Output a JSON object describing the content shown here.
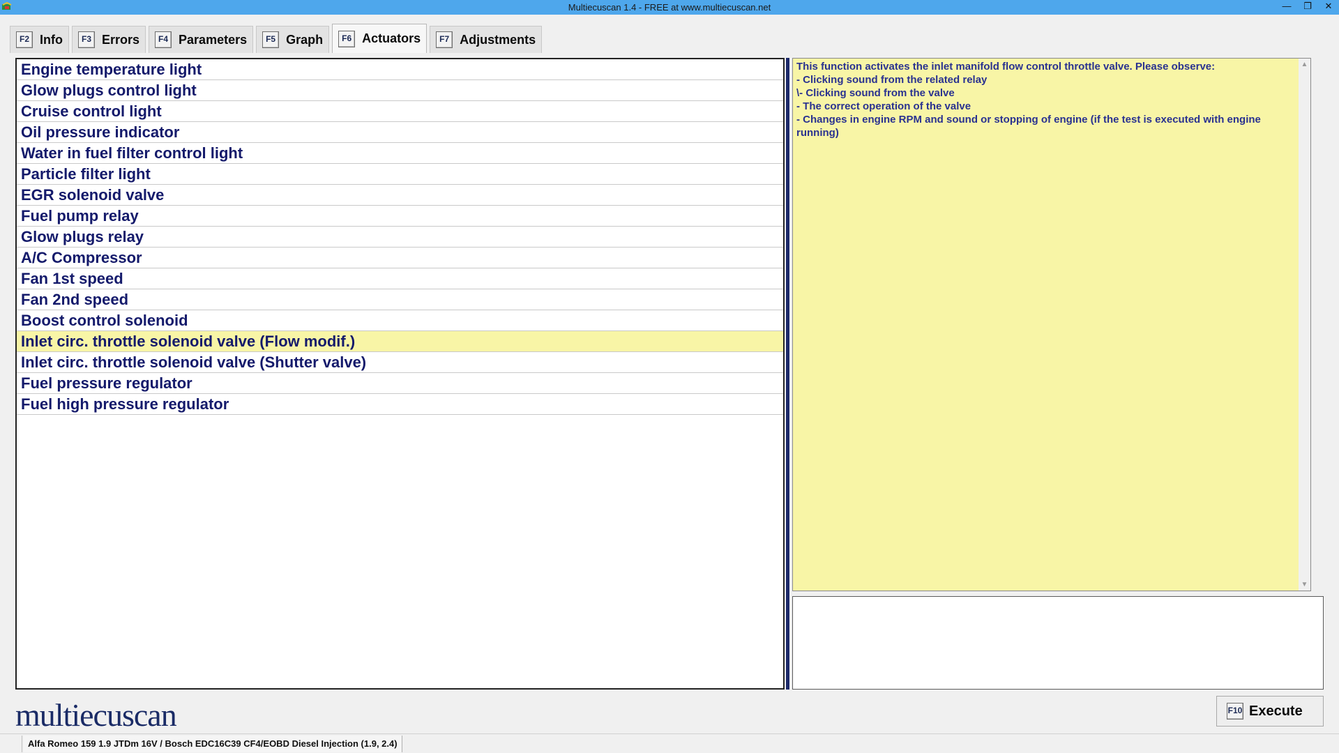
{
  "window": {
    "title": "Multiecuscan 1.4 - FREE at www.multiecuscan.net",
    "min_glyph": "—",
    "max_glyph": "❐",
    "close_glyph": "✕"
  },
  "tabs": [
    {
      "fkey": "F2",
      "label": "Info"
    },
    {
      "fkey": "F3",
      "label": "Errors"
    },
    {
      "fkey": "F4",
      "label": "Parameters"
    },
    {
      "fkey": "F5",
      "label": "Graph"
    },
    {
      "fkey": "F6",
      "label": "Actuators"
    },
    {
      "fkey": "F7",
      "label": "Adjustments"
    }
  ],
  "active_tab": "Actuators",
  "actuators": [
    "Engine temperature light",
    "Glow plugs control light",
    "Cruise control light",
    "Oil pressure indicator",
    "Water in fuel filter control light",
    "Particle filter light",
    "EGR solenoid valve",
    "Fuel pump relay",
    "Glow plugs relay",
    "A/C Compressor",
    "Fan 1st speed",
    "Fan 2nd speed",
    "Boost control solenoid",
    "Inlet circ. throttle solenoid valve (Flow modif.)",
    "Inlet circ. throttle solenoid valve (Shutter valve)",
    "Fuel pressure regulator",
    "Fuel high pressure regulator"
  ],
  "selected_index": 13,
  "description": [
    "This function activates the inlet manifold flow control throttle valve. Please observe:",
    "- Clicking sound from the related relay",
    "\\- Clicking sound from the valve",
    "- The correct operation of the valve",
    "- Changes in engine RPM and sound or stopping of engine (if the test is executed with engine running)"
  ],
  "scroll": {
    "up": "▲",
    "down": "▼"
  },
  "logo_text": "multiecuscan",
  "execute": {
    "fkey": "F10",
    "label": "Execute"
  },
  "status": {
    "vehicle": "Alfa Romeo 159 1.9 JTDm 16V / Bosch EDC16C39 CF4/EOBD Diesel Injection (1.9, 2.4)"
  },
  "colors": {
    "titlebar": "#4ea7ec",
    "list_text": "#141a6b",
    "highlight": "#f8f5a6",
    "divider": "#1d2a6a"
  }
}
